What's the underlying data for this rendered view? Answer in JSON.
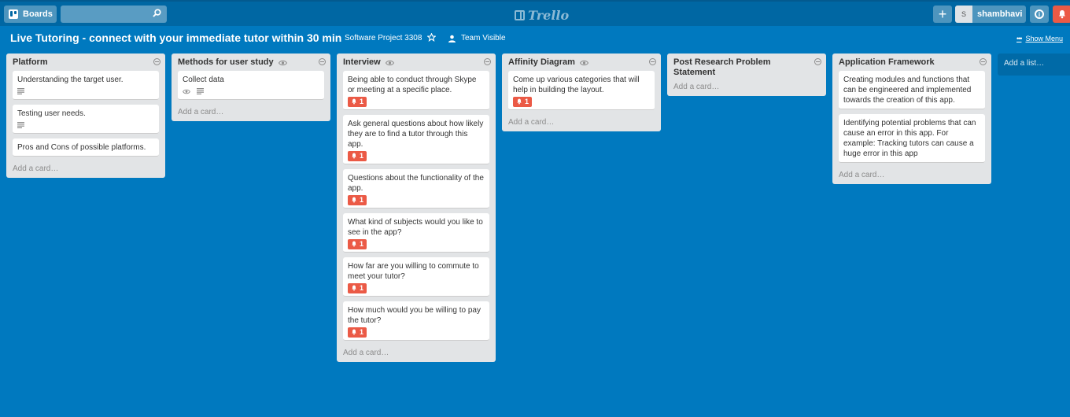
{
  "header": {
    "boards_label": "Boards",
    "search_placeholder": "",
    "logo_text": "Trello",
    "add_label": "+",
    "avatar_initial": "S",
    "username": "shambhavi",
    "info_label": "i"
  },
  "board": {
    "title": "Live Tutoring - connect with your immediate tutor within 30 min",
    "project": "Software Project 3308",
    "visibility": "Team Visible",
    "show_menu": "Show Menu"
  },
  "lists": [
    {
      "title": "Platform",
      "cards": [
        {
          "text": "Understanding the target user."
        },
        {
          "text": "Testing user needs."
        },
        {
          "text": "Pros and Cons of possible platforms."
        }
      ],
      "add_card": "Add a card…"
    },
    {
      "title": "Methods for user study",
      "cards": [
        {
          "text": "Collect data"
        }
      ],
      "add_card": "Add a card…"
    },
    {
      "title": "Interview",
      "cards": [
        {
          "text": "Being able to conduct through Skype or meeting at a specific place.",
          "badge": "1"
        },
        {
          "text": "Ask general questions about how likely they are to find a tutor through this app.",
          "badge": "1"
        },
        {
          "text": "Questions about the functionality of the app.",
          "badge": "1"
        },
        {
          "text": "What kind of subjects would you like to see in the app?",
          "badge": "1"
        },
        {
          "text": "How far are you willing to commute to meet your tutor?",
          "badge": "1"
        },
        {
          "text": "How much would you be willing to pay the tutor?",
          "badge": "1"
        }
      ],
      "add_card": "Add a card…"
    },
    {
      "title": "Affinity Diagram",
      "cards": [
        {
          "text": "Come up various categories that will help in building the layout.",
          "badge": "1"
        }
      ],
      "add_card": "Add a card…"
    },
    {
      "title": "Post Research Problem Statement",
      "cards": [],
      "add_card": "Add a card…"
    },
    {
      "title": "Application Framework",
      "cards": [
        {
          "text": "Creating modules and functions that can be engineered and implemented towards the creation of this app."
        },
        {
          "text": "Identifying potential problems that can cause an error in this app. For example: Tracking tutors can cause a huge error in this app"
        }
      ],
      "add_card": "Add a card…"
    }
  ],
  "add_list": "Add a list…",
  "colors": {
    "board_bg": "#0079bf",
    "header_bg": "#0067a3",
    "list_bg": "#e2e4e6",
    "badge_red": "#eb5a46"
  }
}
